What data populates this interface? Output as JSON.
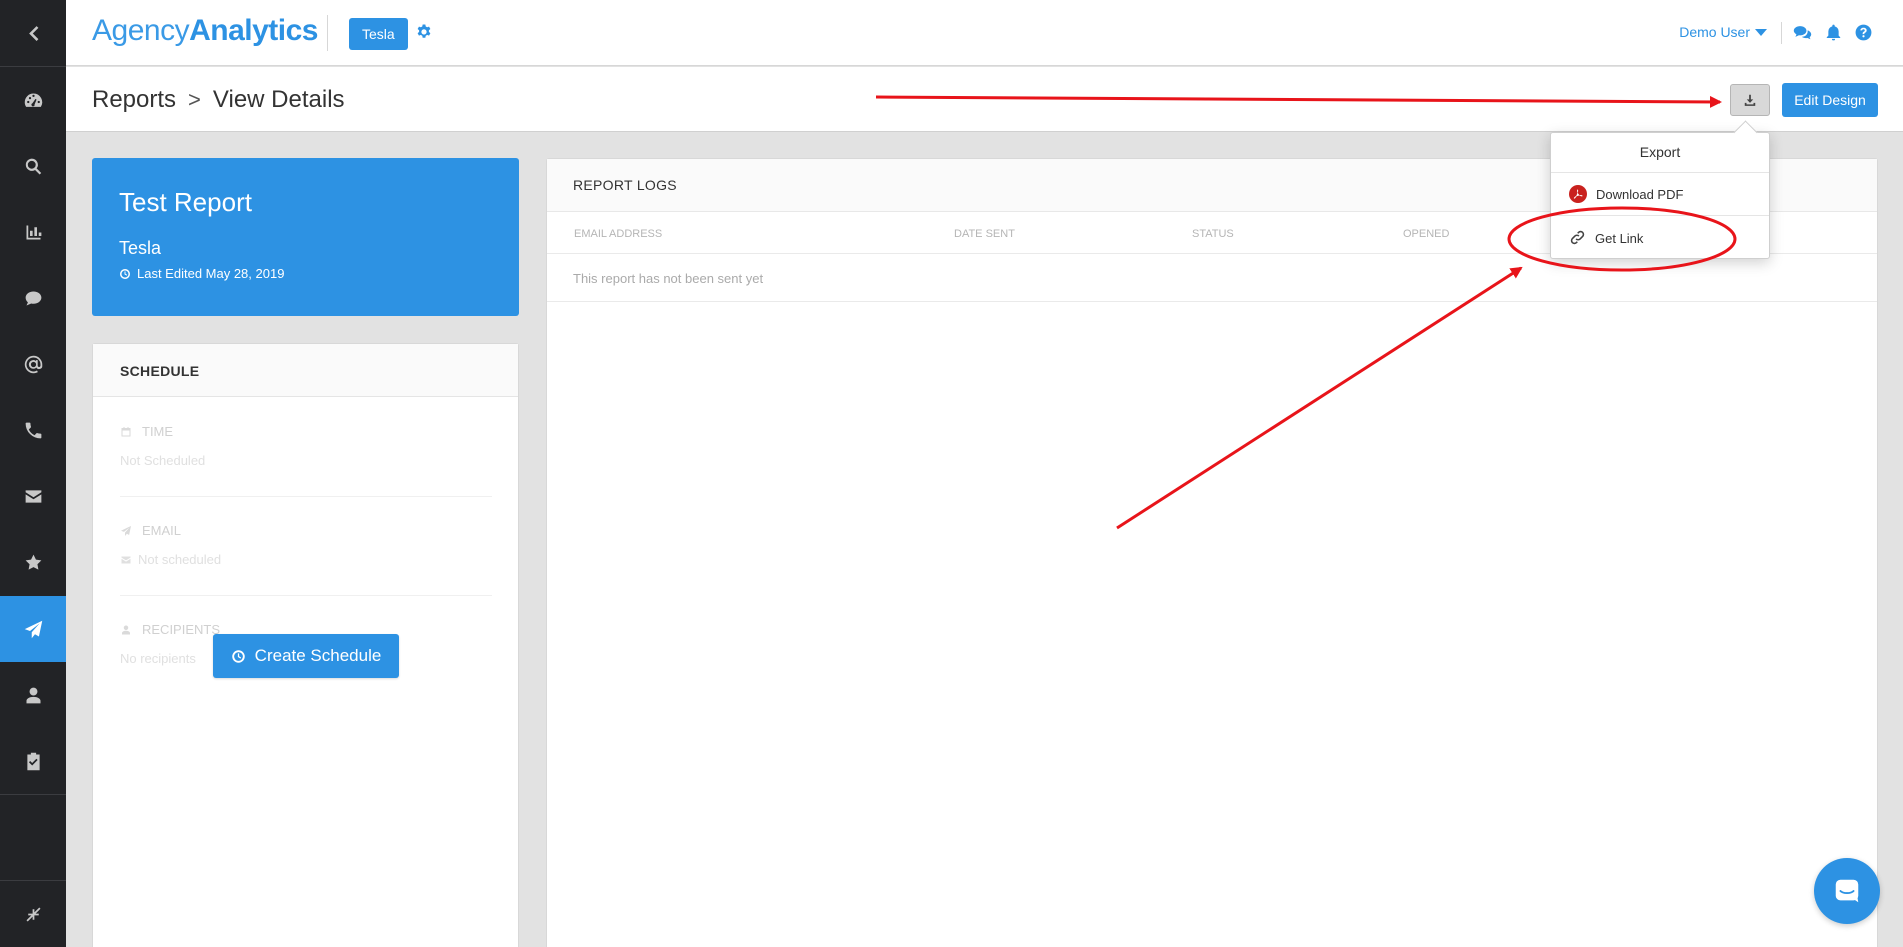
{
  "app": {
    "logo_part1": "Agency",
    "logo_part2": "Analytics",
    "client_button": "Tesla",
    "user_name": "Demo User"
  },
  "breadcrumb": {
    "parent": "Reports",
    "separator": ">",
    "current": "View Details"
  },
  "actions": {
    "edit_design": "Edit Design"
  },
  "report": {
    "title": "Test Report",
    "client": "Tesla",
    "last_edited": "Last Edited May 28, 2019"
  },
  "schedule": {
    "heading": "SCHEDULE",
    "time_label": "TIME",
    "time_value": "Not Scheduled",
    "email_label": "EMAIL",
    "email_value": "Not scheduled",
    "recipients_label": "RECIPIENTS",
    "recipients_value": "No recipients",
    "create_button": "Create Schedule"
  },
  "logs": {
    "heading": "REPORT LOGS",
    "columns": [
      "EMAIL ADDRESS",
      "DATE SENT",
      "STATUS",
      "OPENED"
    ],
    "empty_message": "This report has not been sent yet"
  },
  "export_menu": {
    "title": "Export",
    "items": [
      "Download PDF",
      "Get Link"
    ]
  },
  "sidebar": {
    "items": [
      "back-icon",
      "dashboard-icon",
      "search-icon",
      "bar-chart-icon",
      "comment-icon",
      "at-sign-icon",
      "phone-icon",
      "envelope-icon",
      "star-icon",
      "paper-plane-icon",
      "user-icon",
      "clipboard-check-icon",
      "compress-icon"
    ],
    "active": "paper-plane-icon"
  },
  "colors": {
    "accent": "#2d92e3",
    "sidebar_bg": "#222326",
    "annotation_red": "#e8141a",
    "pdf_red": "#c9211e"
  }
}
